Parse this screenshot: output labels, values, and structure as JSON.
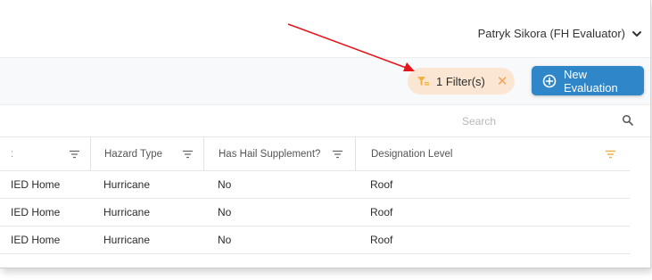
{
  "header": {
    "user_name": "Patryk Sikora (FH Evaluator)"
  },
  "toolbar": {
    "filter_chip_label": "1 Filter(s)",
    "filter_chip_close": "✕",
    "new_evaluation_label": "New Evaluation"
  },
  "search": {
    "placeholder": "Search"
  },
  "table": {
    "columns": [
      {
        "label": "ː",
        "filtered": false
      },
      {
        "label": "Hazard Type",
        "filtered": false
      },
      {
        "label": "Has Hail Supplement?",
        "filtered": false
      },
      {
        "label": "Designation Level",
        "filtered": true
      }
    ],
    "rows": [
      [
        "IED Home",
        "Hurricane",
        "No",
        "Roof"
      ],
      [
        "IED Home",
        "Hurricane",
        "No",
        "Roof"
      ],
      [
        "IED Home",
        "Hurricane",
        "No",
        "Roof"
      ]
    ]
  },
  "colors": {
    "accent_blue": "#2f87c9",
    "filter_chip_bg": "#fbe6d3",
    "filter_active": "#f2b23e",
    "annotation_arrow": "#e8141b"
  },
  "icons": {
    "user_menu": "chevron-down-icon",
    "filter_chip": "filter-active-icon",
    "new_evaluation": "plus-circle-icon",
    "search": "search-icon",
    "column_filter": "filter-lines-icon"
  }
}
